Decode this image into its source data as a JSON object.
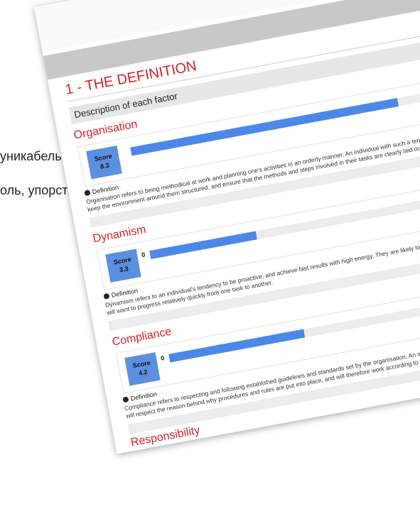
{
  "background_text": {
    "line1": "уникабельность,",
    "line2": "оль, упорство"
  },
  "section": {
    "title": "1 - THE DEFINITION",
    "description": "Description of each factor",
    "max": "10"
  },
  "factors": [
    {
      "name": "Organisation",
      "score_label": "Score",
      "score": "8.3",
      "bar_fraction": 0.83,
      "zero_label": "",
      "definition_label": "Definition",
      "definition": "Organisation refers to being methodical at work and planning one's activities in an orderly manner. An individual with such a tendency is likely to keep the environment around them structured, and ensure that the methods and steps involved in their tasks are clearly laid out and precise.",
      "scale_max": "10"
    },
    {
      "name": "Dynamism",
      "score_label": "Score",
      "score": "3.3",
      "bar_fraction": 0.33,
      "zero_label": "0",
      "definition_label": "Definition",
      "definition": "Dynamism refers to an individual's tendency to be proactive, and achieve fast results with high energy. They are likely to work vigorously, and will want to progress relatively quickly from one task to another.",
      "scale_max": "10"
    },
    {
      "name": "Compliance",
      "score_label": "Score",
      "score": "4.2",
      "bar_fraction": 0.42,
      "zero_label": "0",
      "definition_label": "Definition",
      "definition": "Compliance refers to respecting and following established guidelines and standards set by the organisation. An individual with such a tendency will respect the reason behind why procedures and rules are put into place, and will therefore work according to them.",
      "scale_max": "10"
    },
    {
      "name": "Responsibility"
    }
  ],
  "colors": {
    "accent_red": "#d0202a",
    "bar_blue": "#4c88e8",
    "score_blue": "#5b8fe0"
  }
}
